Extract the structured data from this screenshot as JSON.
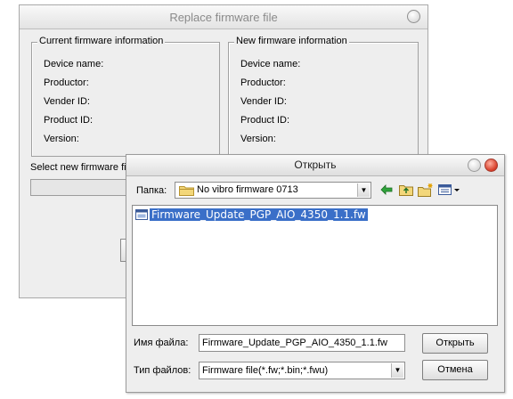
{
  "back_window": {
    "title": "Replace firmware file",
    "current_group": {
      "legend": "Current firmware information",
      "rows": [
        "Device name:",
        "Productor:",
        "Vender ID:",
        "Product ID:",
        "Version:"
      ]
    },
    "new_group": {
      "legend": "New firmware information",
      "rows": [
        "Device name:",
        "Productor:",
        "Vender ID:",
        "Product ID:",
        "Version:"
      ]
    },
    "select_label": "Select new firmware file"
  },
  "open_dialog": {
    "title": "Открыть",
    "folder_label": "Папка:",
    "folder_value": "No vibro firmware 0713",
    "files": [
      {
        "name": "Firmware_Update_PGP_AIO_4350_1.1.fw",
        "selected": true
      }
    ],
    "filename_label": "Имя файла:",
    "filename_value": "Firmware_Update_PGP_AIO_4350_1.1.fw",
    "filetype_label": "Тип файлов:",
    "filetype_value": "Firmware file(*.fw;*.bin;*.fwu)",
    "open_button": "Открыть",
    "cancel_button": "Отмена",
    "toolbar_icons": [
      "back-arrow-icon",
      "up-folder-icon",
      "new-folder-icon",
      "view-menu-icon"
    ]
  },
  "colors": {
    "selection": "#3a6fc8",
    "close_button": "#d63b26",
    "window_bg": "#eeeeee"
  }
}
